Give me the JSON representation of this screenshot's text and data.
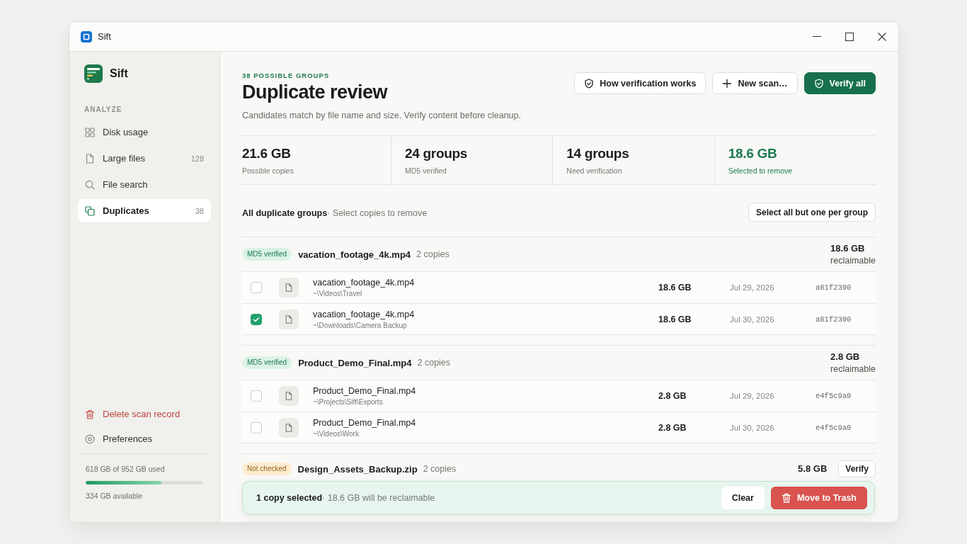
{
  "window": {
    "title": "Sift"
  },
  "sidebar": {
    "brand": "Sift",
    "section_label": "ANALYZE",
    "items": [
      {
        "label": "Disk usage",
        "selected": false
      },
      {
        "label": "Large files",
        "count": "128",
        "selected": false
      },
      {
        "label": "File search",
        "selected": false
      },
      {
        "label": "Duplicates",
        "count": "38",
        "selected": true
      }
    ],
    "footer_items": [
      {
        "label": "Delete scan record",
        "kind": "danger"
      },
      {
        "label": "Preferences",
        "kind": "normal"
      }
    ],
    "storage": {
      "used_text": "618 GB of 952 GB used",
      "level": 0.65,
      "available_text": "334 GB available"
    }
  },
  "header": {
    "eyebrow": "38 POSSIBLE GROUPS",
    "title": "Duplicate review",
    "subtitle": "Candidates match by file name and size. Verify content before cleanup.",
    "actions": [
      {
        "label": "How verification works",
        "kind": "secondary"
      },
      {
        "label": "New scan…",
        "kind": "secondary"
      },
      {
        "label": "Verify all",
        "kind": "primary"
      }
    ]
  },
  "stats": [
    {
      "value": "21.6 GB",
      "label": "Possible copies",
      "highlight": false
    },
    {
      "value": "24 groups",
      "label": "MD5 verified",
      "highlight": false
    },
    {
      "value": "14 groups",
      "label": "Need verification",
      "highlight": false
    },
    {
      "value": "18.6 GB",
      "label": "Selected to remove",
      "highlight": true
    }
  ],
  "list_header": {
    "title": "All duplicate groups",
    "hint": "· Select copies to remove",
    "action": "Select all but one per group"
  },
  "groups": [
    {
      "kind": "verified",
      "badge": "MD5 verified",
      "name": "vacation_footage_4k.mp4",
      "copies": "2 copies",
      "size": "18.6 GB",
      "size_note": "reclaimable",
      "files": [
        {
          "name": "vacation_footage_4k.mp4",
          "path": "~\\Videos\\Travel",
          "size": "18.6 GB",
          "date": "Jul 29, 2026",
          "hash": "a81f2390",
          "checked": false
        },
        {
          "name": "vacation_footage_4k.mp4",
          "path": "~\\Downloads\\Camera Backup",
          "size": "18.6 GB",
          "date": "Jul 30, 2026",
          "hash": "a81f2390",
          "checked": true
        }
      ]
    },
    {
      "kind": "verified",
      "badge": "MD5 verified",
      "name": "Product_Demo_Final.mp4",
      "copies": "2 copies",
      "size": "2.8 GB",
      "size_note": "reclaimable",
      "files": [
        {
          "name": "Product_Demo_Final.mp4",
          "path": "~\\Projects\\Sift\\Exports",
          "size": "2.8 GB",
          "date": "Jul 29, 2026",
          "hash": "e4f5c9a0",
          "checked": false
        },
        {
          "name": "Product_Demo_Final.mp4",
          "path": "~\\Videos\\Work",
          "size": "2.8 GB",
          "date": "Jul 30, 2026",
          "hash": "e4f5c9a0",
          "checked": false
        }
      ]
    },
    {
      "kind": "unchecked",
      "badge": "Not checked",
      "name": "Design_Assets_Backup.zip",
      "copies": "2 copies",
      "size": "5.8 GB",
      "verify_button": "Verify"
    }
  ],
  "selection_bar": {
    "count": "1 copy selected",
    "detail": "· 18.6 GB will be reclaimable",
    "clear": "Clear",
    "trash": "Move to Trash"
  }
}
